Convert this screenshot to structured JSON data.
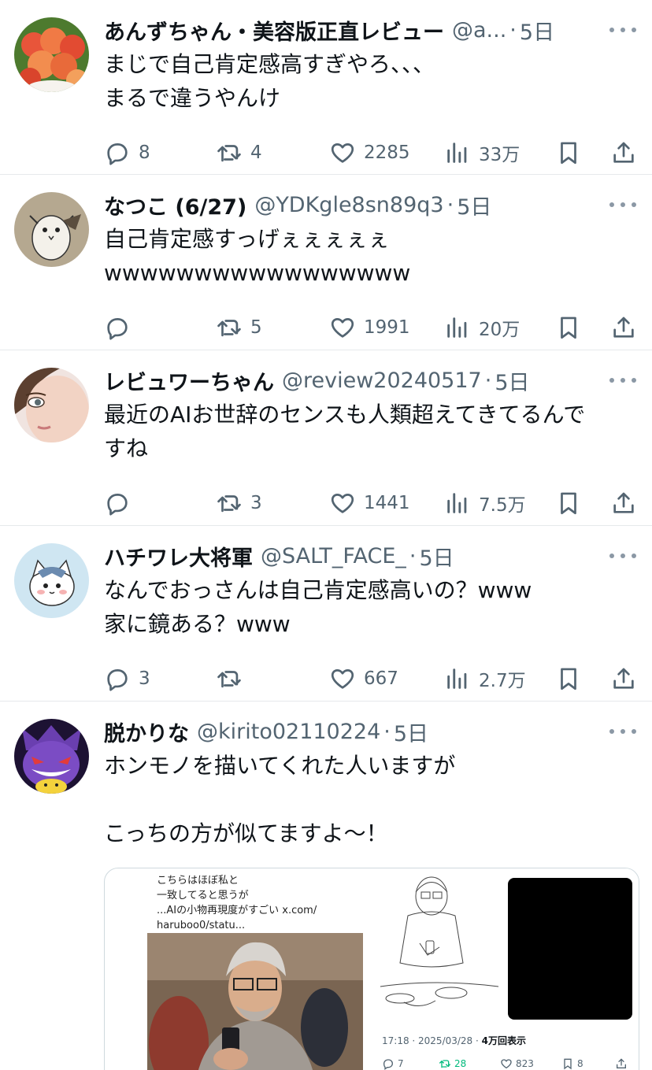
{
  "posts": [
    {
      "name": "あんずちゃん・美容版正直レビュー",
      "handle": "@a...",
      "sep": "·",
      "time": "5日",
      "text": "まじで自己肯定感高すぎやろ、、、\nまるで違うやんけ",
      "replies": "8",
      "reposts": "4",
      "likes": "2285",
      "views": "33万",
      "avatar_icon": "peaches-avatar"
    },
    {
      "name": "なつこ (6/27)",
      "handle": "@YDKgle8sn89q3",
      "sep": "·",
      "time": "5日",
      "text": "自己肯定感すっげぇぇぇぇぇ\nwwwwwwwwwwwwwwwww",
      "replies": "",
      "reposts": "5",
      "likes": "1991",
      "views": "20万",
      "avatar_icon": "owl-drawing-avatar"
    },
    {
      "name": "レビュワーちゃん",
      "handle": "@review20240517",
      "sep": "·",
      "time": "5日",
      "text": "最近のAIお世辞のセンスも人類超えてきてるんで\nすね",
      "replies": "",
      "reposts": "3",
      "likes": "1441",
      "views": "7.5万",
      "avatar_icon": "woman-face-avatar"
    },
    {
      "name": "ハチワレ大将軍",
      "handle": "@SALT_FACE_",
      "sep": "·",
      "time": "5日",
      "text": "なんでおっさんは自己肯定感高いの？www\n家に鏡ある？www",
      "replies": "3",
      "reposts": "",
      "likes": "667",
      "views": "2.7万",
      "avatar_icon": "cat-character-avatar"
    },
    {
      "name": "脱かりな",
      "handle": "@kirito02110224",
      "sep": "·",
      "time": "5日",
      "text": "ホンモノを描いてくれた人いますが\n\nこっちの方が似てますよ〜！",
      "avatar_icon": "purple-monster-avatar",
      "media": {
        "caption": "こちらはほぼ私と\n一致してると思うが\n...AIの小物再現度がすごい x.com/\nharuboo0/statu...",
        "meta_time": "17:18 · 2025/03/28 · ",
        "meta_views": "4万回表示",
        "mini_replies": "7",
        "mini_reposts": "28",
        "mini_likes": "823",
        "mini_bookmarks": "8"
      }
    }
  ]
}
